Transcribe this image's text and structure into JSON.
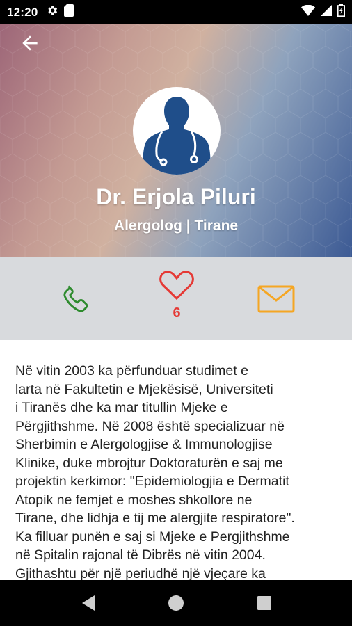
{
  "status_bar": {
    "time": "12:20",
    "icons": [
      "gear-icon",
      "sim-card-icon",
      "wifi-icon",
      "signal-icon",
      "battery-icon"
    ]
  },
  "profile": {
    "name": "Dr. Erjola Piluri",
    "subtitle": "Alergolog | Tirane",
    "avatar_icon": "doctor-avatar-icon"
  },
  "actions": {
    "call_icon": "phone-icon",
    "like_icon": "heart-icon",
    "like_count": "6",
    "mail_icon": "mail-icon"
  },
  "bio": {
    "lines": [
      "Në vitin 2003 ka përfunduar studimet e",
      "larta në Fakultetin e Mjekësisë, Universiteti",
      "i Tiranës dhe ka mar titullin Mjeke e",
      "Përgjithshme. Në 2008 është specializuar në",
      "Sherbimin e Alergologjise & Immunologjise",
      "Klinike, duke mbrojtur Doktoraturën e saj me",
      "projektin kerkimor: \"Epidemiologjia e Dermatit",
      "Atopik ne femjet e  moshes shkollore ne",
      "Tirane, dhe lidhja e tij me alergjite respiratore\".",
      "Ka filluar punën e saj si Mjeke e Pergjithshme",
      "në Spitalin rajonal të Dibrës në vitin 2004.",
      "Gjithashtu për një periudhë një vjeçare ka"
    ]
  },
  "colors": {
    "call": "#2e8b2e",
    "like": "#e53935",
    "mail": "#f5a623",
    "avatar_figure": "#1f4e8a"
  },
  "nav_bar": {
    "icons": [
      "back-triangle-icon",
      "home-circle-icon",
      "recents-square-icon"
    ]
  }
}
